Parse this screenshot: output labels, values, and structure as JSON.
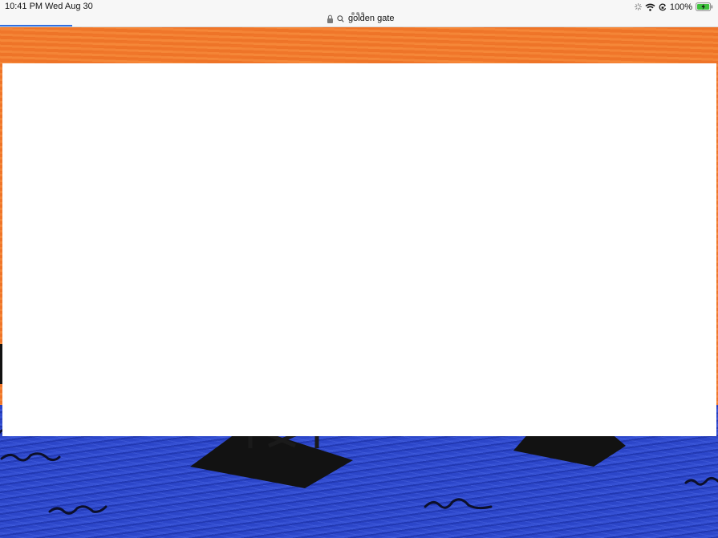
{
  "status_bar": {
    "time": "10:41 PM",
    "date": "Wed Aug 30",
    "battery_percent": "100%",
    "icons": [
      "loading-spinner-icon",
      "wifi-icon",
      "orientation-lock-icon",
      "battery-charging-icon"
    ]
  },
  "address_bar": {
    "query": "golden gate",
    "icons": [
      "lock-icon",
      "search-icon"
    ],
    "more_icon": "ellipsis-icon"
  },
  "page_load_progress": 0.1,
  "colors": {
    "sky": "#f0782a",
    "water": "#2c46c9",
    "progress": "#2f6fe3",
    "panel": "#ffffff",
    "battery": "#3cc13b"
  },
  "artwork": {
    "subject": "Golden Gate painting",
    "elements": [
      "orange-sky",
      "blue-water",
      "bridge-tower-base-left",
      "bridge-tower-base-right",
      "wave-strokes"
    ]
  }
}
